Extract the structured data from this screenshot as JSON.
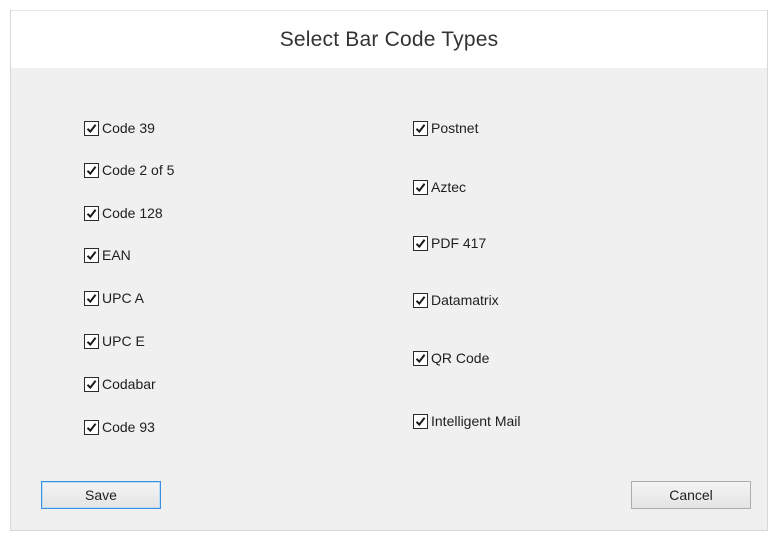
{
  "dialog": {
    "title": "Select Bar Code Types"
  },
  "left_column": [
    {
      "label": "Code 39",
      "checked": true
    },
    {
      "label": "Code 2 of 5",
      "checked": true
    },
    {
      "label": "Code 128",
      "checked": true
    },
    {
      "label": "EAN",
      "checked": true
    },
    {
      "label": "UPC A",
      "checked": true
    },
    {
      "label": "UPC E",
      "checked": true
    },
    {
      "label": "Codabar",
      "checked": true
    },
    {
      "label": "Code 93",
      "checked": true
    }
  ],
  "right_column": [
    {
      "label": "Postnet",
      "checked": true
    },
    {
      "label": "Aztec",
      "checked": true
    },
    {
      "label": "PDF 417",
      "checked": true
    },
    {
      "label": "Datamatrix",
      "checked": true
    },
    {
      "label": "QR Code",
      "checked": true
    },
    {
      "label": "Intelligent Mail",
      "checked": true
    }
  ],
  "buttons": {
    "save_label": "Save",
    "cancel_label": "Cancel"
  },
  "colors": {
    "dialog_background": "#f0f0f0",
    "title_background": "#ffffff",
    "default_button_border": "#3c8fdd"
  },
  "icons": {
    "checkbox_checked": "checkmark-icon"
  }
}
